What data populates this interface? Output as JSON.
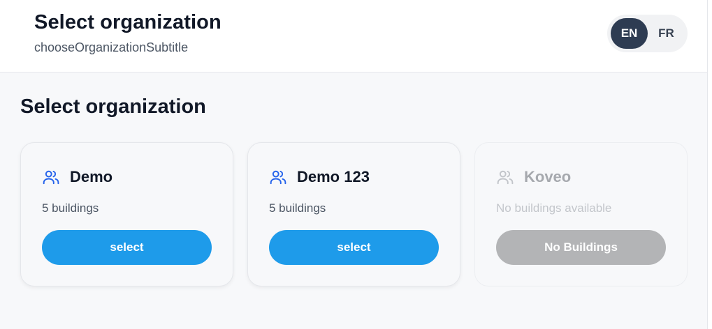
{
  "header": {
    "title": "Select organization",
    "subtitle": "chooseOrganizationSubtitle"
  },
  "language": {
    "options": [
      "EN",
      "FR"
    ],
    "selected": "EN"
  },
  "main": {
    "section_title": "Select organization",
    "organizations": [
      {
        "name": "Demo",
        "buildings": "5 buildings",
        "action": "select",
        "enabled": true,
        "icon": "users-icon"
      },
      {
        "name": "Demo 123",
        "buildings": "5 buildings",
        "action": "select",
        "enabled": true,
        "icon": "users-icon"
      },
      {
        "name": "Koveo",
        "buildings": "No buildings available",
        "action": "No Buildings",
        "enabled": false,
        "icon": "users-icon"
      }
    ]
  },
  "colors": {
    "accent": "#1e9bea",
    "icon_blue": "#2563eb",
    "active_lang_bg": "#2e3c52",
    "disabled_button": "#b3b4b6"
  }
}
